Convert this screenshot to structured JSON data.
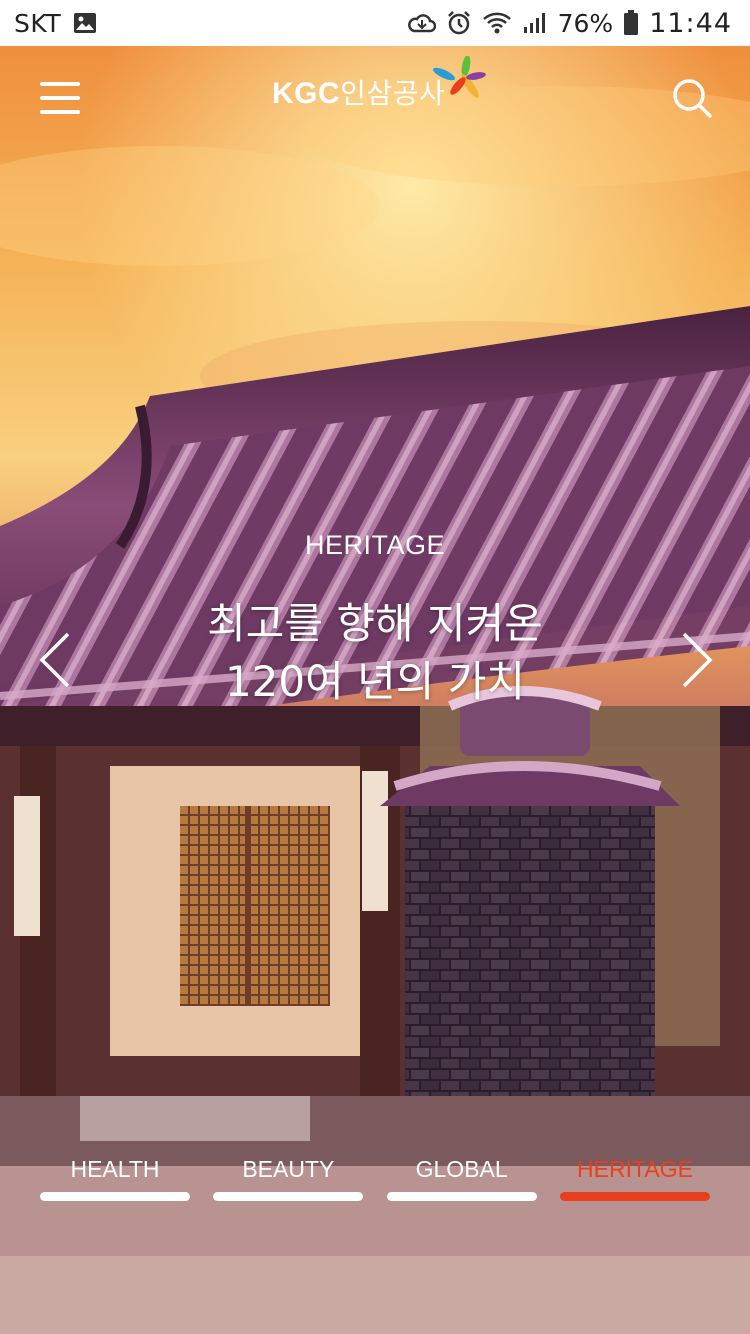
{
  "status_bar": {
    "carrier": "SKT",
    "battery": "76%",
    "time": "11:44",
    "icons": [
      "image-icon",
      "cloud-sync-icon",
      "alarm-icon",
      "wifi-icon",
      "signal-icon",
      "battery-icon"
    ]
  },
  "header": {
    "logo_brand": "KGC",
    "logo_korean": "인삼공사",
    "menu_icon": "hamburger-menu-icon",
    "search_icon": "search-icon"
  },
  "hero": {
    "kicker": "HERITAGE",
    "title_line1": "최고를 향해 지켜온",
    "title_line2": "120여 년의 가치"
  },
  "tabs": [
    {
      "label": "HEALTH",
      "active": false
    },
    {
      "label": "BEAUTY",
      "active": false
    },
    {
      "label": "GLOBAL",
      "active": false
    },
    {
      "label": "HERITAGE",
      "active": true
    }
  ],
  "colors": {
    "accent": "#e8401d",
    "sky_top": "#f3a24a",
    "roof": "#6b3a63"
  }
}
